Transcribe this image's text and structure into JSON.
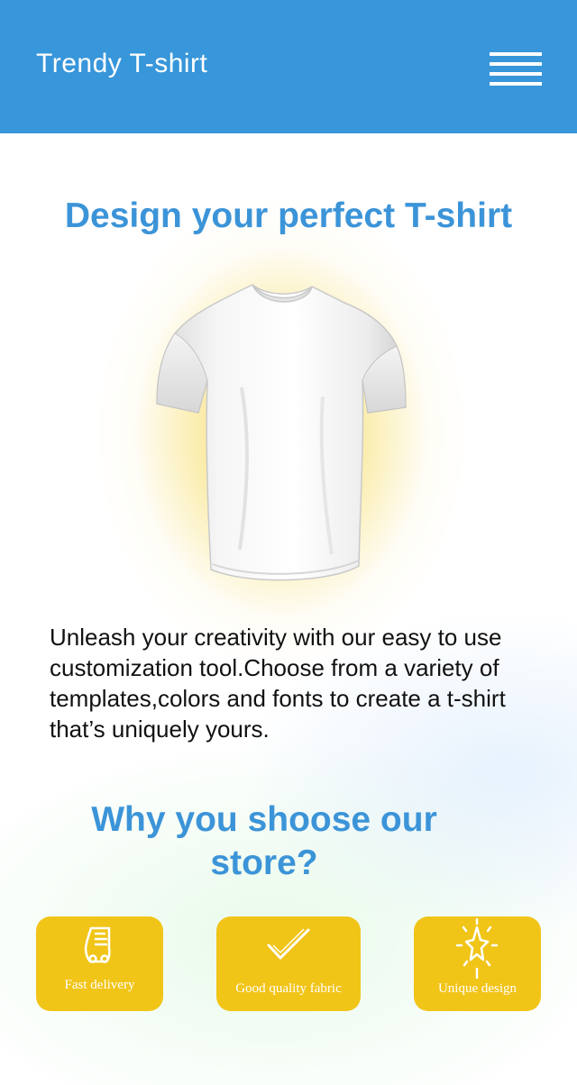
{
  "header": {
    "brand": "Trendy T-shirt",
    "menu_icon": "hamburger-menu-icon",
    "background": "#3896da"
  },
  "hero": {
    "title": "Design your perfect T-shirt",
    "image": "white-tshirt-image",
    "description": "Unleash your creativity with our easy to use customization tool.Choose from a variety of templates,colors and fonts to create a t-shirt that’s uniquely yours."
  },
  "why": {
    "title": "Why you shoose our store?"
  },
  "features": [
    {
      "label": "Fast delivery",
      "icon": "delivery-icon"
    },
    {
      "label": "Good quality fabric",
      "icon": "checkmark-icon"
    },
    {
      "label": "Unique design",
      "icon": "sparkle-star-icon"
    }
  ],
  "colors": {
    "accent": "#3c94d8",
    "feature_card": "#f1c418"
  }
}
